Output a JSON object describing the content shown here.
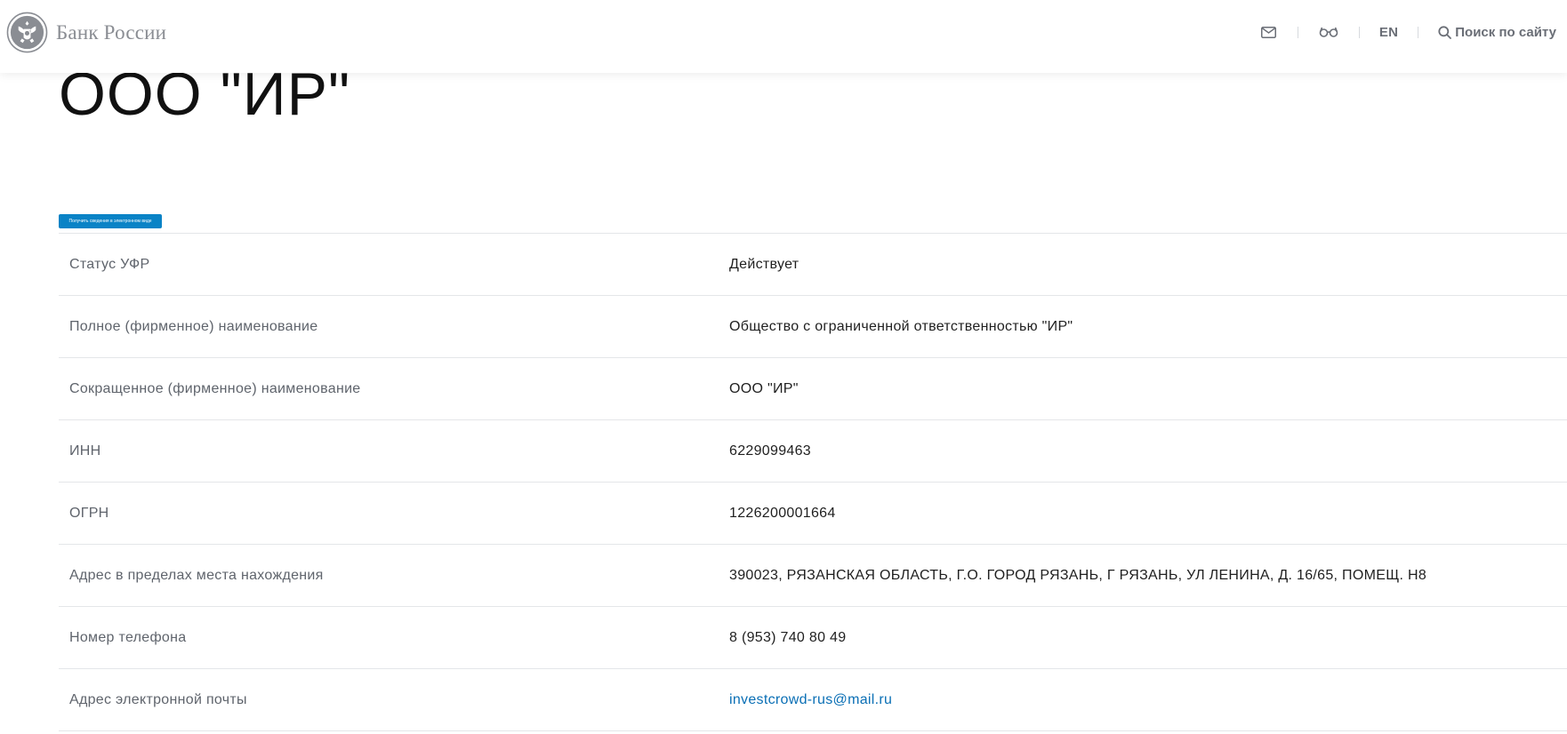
{
  "header": {
    "logo_text": "Банк России",
    "icons": {
      "mail": "mail-icon",
      "accessibility": "glasses-icon",
      "search": "search-icon",
      "emblem": "eagle-emblem-icon"
    },
    "lang_label": "EN",
    "search_label": "Поиск по сайту"
  },
  "page": {
    "title": "ООО \"ИР\"",
    "ecode_button_label": "Получить сведения в электронном виде"
  },
  "rows": [
    {
      "label": "Статус УФР",
      "value": "Действует"
    },
    {
      "label": "Полное (фирменное) наименование",
      "value": "Общество с ограниченной ответственностью \"ИР\""
    },
    {
      "label": "Сокращенное (фирменное) наименование",
      "value": "ООО \"ИР\""
    },
    {
      "label": "ИНН",
      "value": "6229099463"
    },
    {
      "label": "ОГРН",
      "value": "1226200001664"
    },
    {
      "label": "Адрес в пределах места нахождения",
      "value": "390023, РЯЗАНСКАЯ ОБЛАСТЬ, Г.О. ГОРОД РЯЗАНЬ, Г РЯЗАНЬ, УЛ ЛЕНИНА, Д. 16/65, ПОМЕЩ. Н8"
    },
    {
      "label": "Номер телефона",
      "value": "8 (953) 740 80 49"
    },
    {
      "label": "Адрес электронной почты",
      "value": "investcrowd-rus@mail.ru"
    }
  ],
  "colors": {
    "accent": "#0a83c6",
    "link": "#0a6fb5",
    "label": "#5f646c",
    "divider": "#e4e6e9"
  }
}
